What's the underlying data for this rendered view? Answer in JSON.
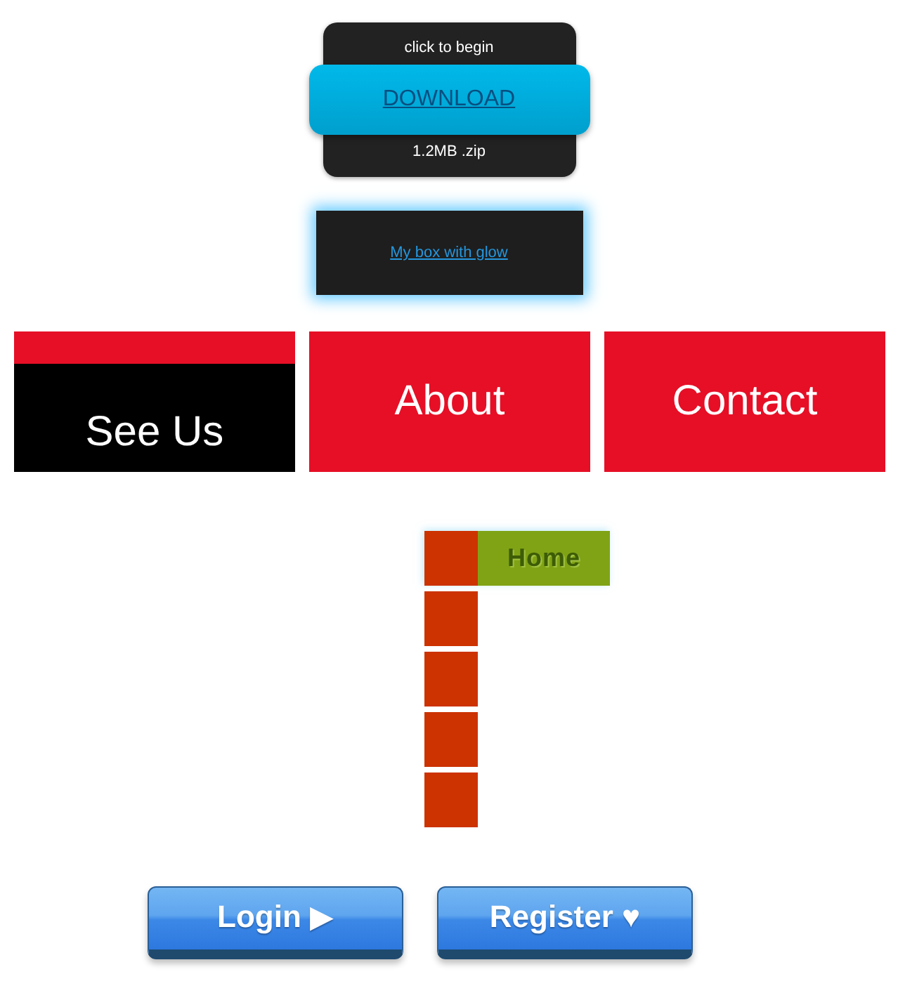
{
  "download_card": {
    "hint": "click to begin",
    "button": "DOWNLOAD",
    "file_info": "1.2MB .zip"
  },
  "glow_box": {
    "link": "My box with glow"
  },
  "nav_tiles": [
    {
      "label": "See Us",
      "highlighted": true
    },
    {
      "label": "About",
      "highlighted": false
    },
    {
      "label": "Contact",
      "highlighted": false
    }
  ],
  "side_menu": [
    {
      "label": "Home",
      "expanded": true
    },
    {
      "expanded": false
    },
    {
      "expanded": false
    },
    {
      "expanded": false
    },
    {
      "expanded": false
    }
  ],
  "buttons": [
    "Login ▶",
    "Register ♥"
  ]
}
